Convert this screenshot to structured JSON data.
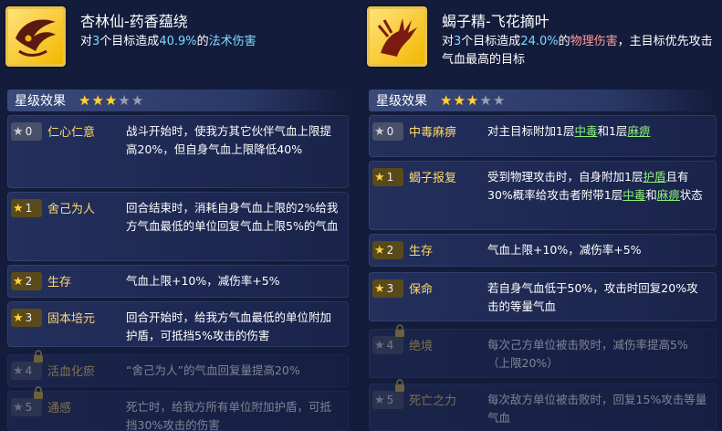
{
  "left": {
    "title": "杏林仙-药香蕴绕",
    "desc_pre": "对",
    "desc_count": "3",
    "desc_mid": "个目标造成",
    "desc_percent": "40.9%",
    "desc_of": "的",
    "desc_type": "法术伤害",
    "desc_post": "",
    "star_label": "星级效果",
    "stars_filled": 3,
    "stars_total": 5,
    "effects": [
      {
        "rank": "0",
        "name": "仁心仁意",
        "desc": "战斗开始时，使我方其它伙伴气血上限提高20%，但自身气血上限降低40%",
        "locked": false,
        "badge": "grey"
      },
      {
        "rank": "1",
        "name": "舍己为人",
        "desc": "回合结束时，消耗自身气血上限的2%给我方气血最低的单位回复气血上限5%的气血",
        "locked": false,
        "badge": "gold"
      },
      {
        "rank": "2",
        "name": "生存",
        "desc": "气血上限+10%，减伤率+5%",
        "locked": false,
        "badge": "gold"
      },
      {
        "rank": "3",
        "name": "固本培元",
        "desc": "回合开始时，给我方气血最低的单位附加护盾，可抵挡5%攻击的伤害",
        "locked": false,
        "badge": "gold"
      },
      {
        "rank": "4",
        "name": "活血化瘀",
        "desc": "“舍己为人”的气血回复量提高20%",
        "locked": true,
        "badge": "grey"
      },
      {
        "rank": "5",
        "name": "通感",
        "desc": "死亡时，给我方所有单位附加护盾，可抵挡30%攻击的伤害",
        "locked": true,
        "badge": "grey"
      }
    ]
  },
  "right": {
    "title": "蝎子精-飞花摘叶",
    "desc_pre": "对",
    "desc_count": "3",
    "desc_mid": "个目标造成",
    "desc_percent": "24.0%",
    "desc_of": "的",
    "desc_type": "物理伤害",
    "desc_post": "，主目标优先攻击气血最高的目标",
    "star_label": "星级效果",
    "stars_filled": 3,
    "stars_total": 5,
    "effects": [
      {
        "rank": "0",
        "name": "中毒麻痹",
        "desc_parts": [
          "对主目标附加1层",
          "中毒",
          "和1层",
          "麻痹",
          ""
        ],
        "locked": false,
        "badge": "grey"
      },
      {
        "rank": "1",
        "name": "蝎子报复",
        "desc_parts": [
          "受到物理攻击时，自身附加1层",
          "护盾",
          "且有30%概率给攻击者附带1层",
          "中毒",
          "和",
          "麻痹",
          "状态"
        ],
        "locked": false,
        "badge": "gold"
      },
      {
        "rank": "2",
        "name": "生存",
        "desc": "气血上限+10%，减伤率+5%",
        "locked": false,
        "badge": "gold"
      },
      {
        "rank": "3",
        "name": "保命",
        "desc": "若自身气血低于50%，攻击时回复20%攻击的等量气血",
        "locked": false,
        "badge": "gold"
      },
      {
        "rank": "4",
        "name": "绝境",
        "desc": "每次己方单位被击败时，减伤率提高5%（上限20%）",
        "locked": true,
        "badge": "grey"
      },
      {
        "rank": "5",
        "name": "死亡之力",
        "desc": "每次敌方单位被击败时，回复15%攻击等量气血",
        "locked": true,
        "badge": "grey"
      }
    ]
  },
  "icons": {
    "left_skill": "wing-swirl-icon",
    "right_skill": "claw-icon",
    "star": "star-icon",
    "lock": "lock-icon"
  },
  "colors": {
    "background": "#141c3c",
    "gold": "#ffd96a",
    "magic": "#7ddcff",
    "physical": "#ff9a9a",
    "link": "#8cf07a"
  }
}
